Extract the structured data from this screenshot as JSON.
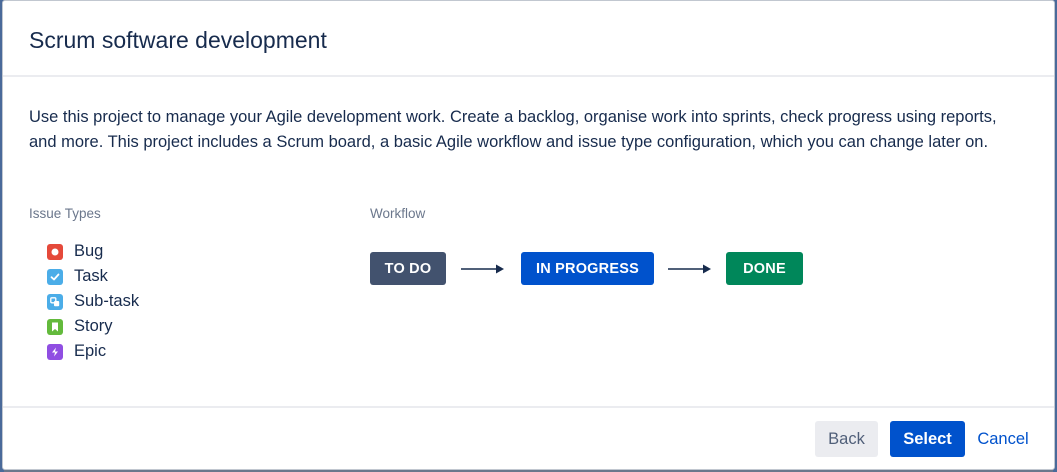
{
  "dialog": {
    "title": "Scrum software development",
    "description": "Use this project to manage your Agile development work. Create a backlog, organise work into sprints, check progress using reports, and more. This project includes a Scrum board, a basic Agile workflow and issue type configuration, which you can change later on."
  },
  "issue_types": {
    "heading": "Issue Types",
    "items": [
      {
        "label": "Bug",
        "icon": "bug-icon",
        "color": "#e5493a"
      },
      {
        "label": "Task",
        "icon": "task-icon",
        "color": "#4bade8"
      },
      {
        "label": "Sub-task",
        "icon": "subtask-icon",
        "color": "#4bade8"
      },
      {
        "label": "Story",
        "icon": "story-icon",
        "color": "#63ba3c"
      },
      {
        "label": "Epic",
        "icon": "epic-icon",
        "color": "#904ee2"
      }
    ]
  },
  "workflow": {
    "heading": "Workflow",
    "statuses": [
      {
        "label": "TO DO",
        "color": "#42526e"
      },
      {
        "label": "IN PROGRESS",
        "color": "#0052cc"
      },
      {
        "label": "DONE",
        "color": "#00875a"
      }
    ]
  },
  "footer": {
    "back_label": "Back",
    "select_label": "Select",
    "cancel_label": "Cancel"
  }
}
